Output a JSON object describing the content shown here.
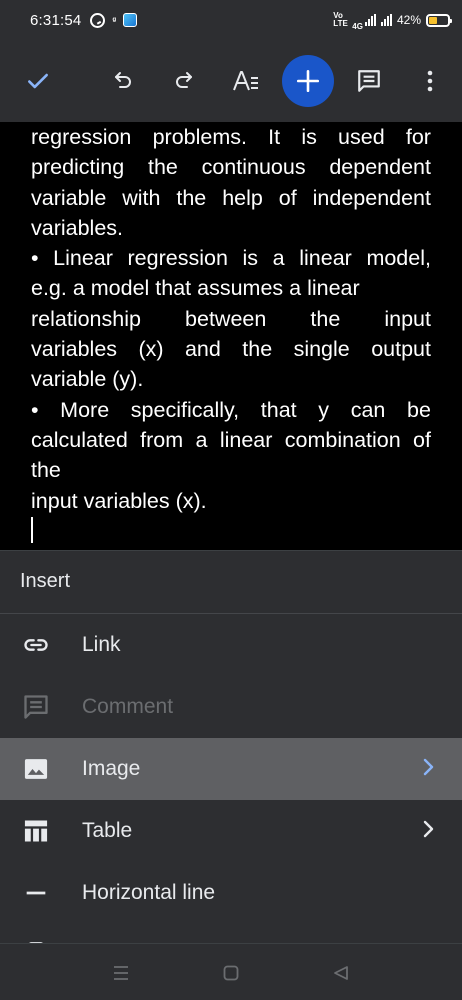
{
  "status_bar": {
    "time": "6:31:54",
    "left_icons": [
      "whatsapp-icon",
      "notification-glyph",
      "app-notification-icon"
    ],
    "notification_glyph": "ᵍ",
    "volte_label": "Vo\nLTE",
    "network_label": "4G",
    "battery_percent": "42%",
    "battery_level": 0.42
  },
  "toolbar": {
    "icons": [
      "check-icon",
      "undo-icon",
      "redo-icon",
      "text-format-icon",
      "insert-plus-icon",
      "comment-icon",
      "more-options-icon"
    ],
    "fab_color": "#1a56c9"
  },
  "document": {
    "lines": [
      "regression problems. It is used for",
      "predicting the continuous dependent",
      "variable with the help of independent",
      "variables.",
      "• Linear regression is a linear model,",
      "e.g. a model that assumes a linear",
      "relationship between the input",
      "variables (x) and the single output",
      "variable (y).",
      "• More specifically, that y can be",
      "calculated from a linear combination of",
      "the",
      "input variables (x)."
    ]
  },
  "insert_menu": {
    "title": "Insert",
    "items": [
      {
        "label": "Link",
        "icon": "link-icon",
        "enabled": true,
        "has_submenu": false
      },
      {
        "label": "Comment",
        "icon": "comment-icon",
        "enabled": false,
        "has_submenu": false
      },
      {
        "label": "Image",
        "icon": "image-icon",
        "enabled": true,
        "has_submenu": true,
        "selected": true
      },
      {
        "label": "Table",
        "icon": "table-icon",
        "enabled": true,
        "has_submenu": true
      },
      {
        "label": "Horizontal line",
        "icon": "horizontal-line-icon",
        "enabled": true,
        "has_submenu": false
      }
    ]
  },
  "nav_bar": {
    "buttons": [
      "recents-icon",
      "home-icon",
      "back-icon"
    ]
  }
}
